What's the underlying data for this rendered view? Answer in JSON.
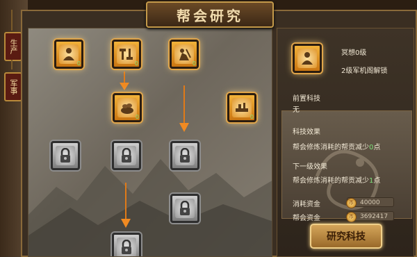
{
  "window": {
    "title": "帮会研究"
  },
  "side_tabs": [
    {
      "label": "生产"
    },
    {
      "label": "军事"
    }
  ],
  "tree": {
    "nodes": [
      {
        "name": "meditation-skill",
        "state": "active",
        "badge": "0"
      },
      {
        "name": "tools-skill",
        "state": "active",
        "badge": "0"
      },
      {
        "name": "farming-skill",
        "state": "active",
        "badge": "0"
      },
      {
        "name": "treasure-skill",
        "state": "active",
        "badge": "0"
      },
      {
        "name": "forge-skill",
        "state": "active",
        "badge": "0"
      },
      {
        "name": "locked-skill-1",
        "state": "locked"
      },
      {
        "name": "locked-skill-2",
        "state": "locked"
      },
      {
        "name": "locked-skill-3",
        "state": "locked"
      },
      {
        "name": "locked-skill-4",
        "state": "locked"
      },
      {
        "name": "locked-skill-5",
        "state": "locked"
      }
    ]
  },
  "detail": {
    "skill_name": "冥想0级",
    "unlock_condition": "2级军机阁解锁",
    "prereq_title": "前置科技",
    "prereq_value": "无",
    "effect_title": "科技效果",
    "effect_prefix": "帮会修炼消耗的帮贡减少",
    "effect_value": "0",
    "effect_suffix": "点",
    "next_title": "下一级效果",
    "next_prefix": "帮会修炼消耗的帮贡减少",
    "next_value": "1",
    "next_suffix": "点",
    "cost_label": "消耗资金",
    "cost_value": "40000",
    "funds_label": "帮会资金",
    "funds_value": "3692417",
    "research_button": "研究科技"
  },
  "colors": {
    "accent": "#f2b23a",
    "highlight": "#7fe07a",
    "locked": "#9a9a9a"
  }
}
